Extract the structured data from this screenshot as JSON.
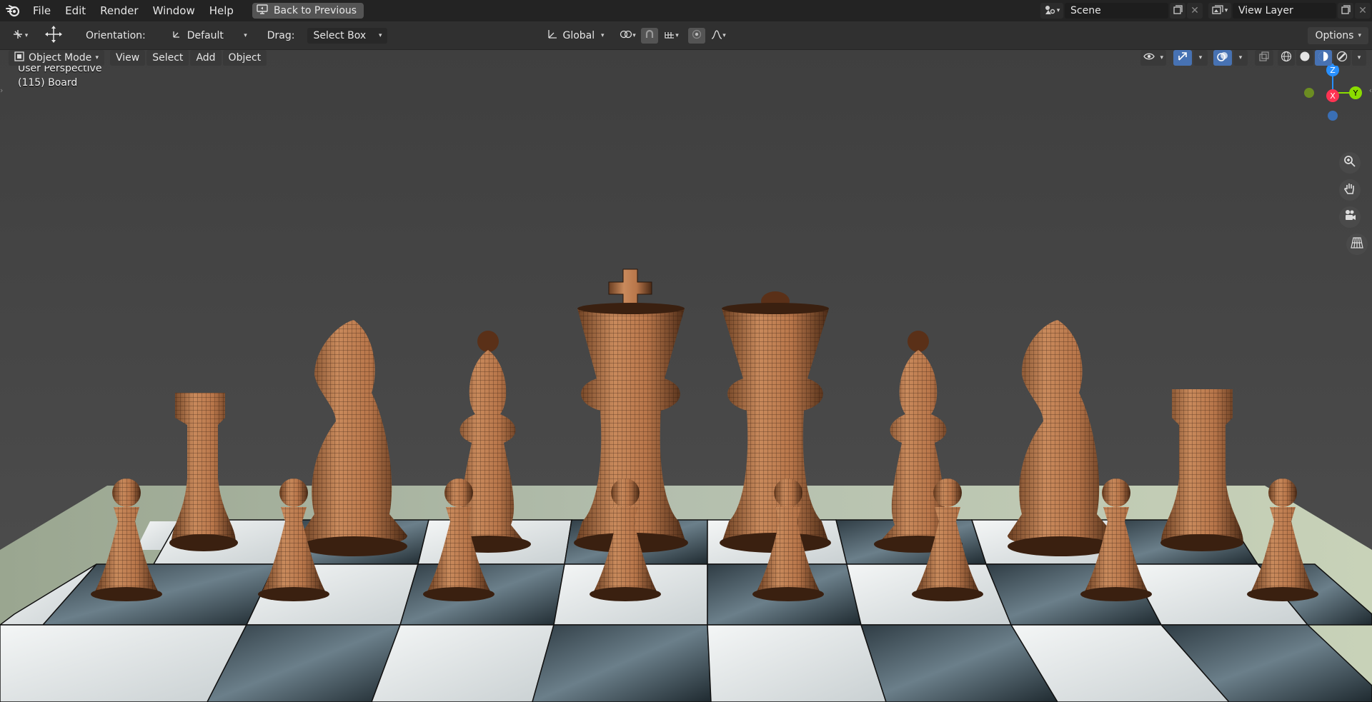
{
  "menu": {
    "items": [
      "File",
      "Edit",
      "Render",
      "Window",
      "Help"
    ],
    "back_button": "Back to Previous"
  },
  "scene": {
    "name": "Scene"
  },
  "view_layer": {
    "name": "View Layer"
  },
  "tool_settings": {
    "orientation_label": "Orientation:",
    "orientation_value": "Default",
    "drag_label": "Drag:",
    "drag_value": "Select Box",
    "transform_orientation": "Global",
    "options_label": "Options"
  },
  "viewport_header": {
    "mode": "Object Mode",
    "menus": [
      "View",
      "Select",
      "Add",
      "Object"
    ]
  },
  "viewport": {
    "perspective_label": "User Perspective",
    "object_label": "(115) Board"
  },
  "gizmo": {
    "z": "Z",
    "x": "X",
    "y": "Y"
  },
  "colors": {
    "axis_x": "#ff3352",
    "axis_y": "#8bdc00",
    "axis_z": "#2890ff",
    "accent": "#4772b3",
    "wood": "#b8764a"
  }
}
